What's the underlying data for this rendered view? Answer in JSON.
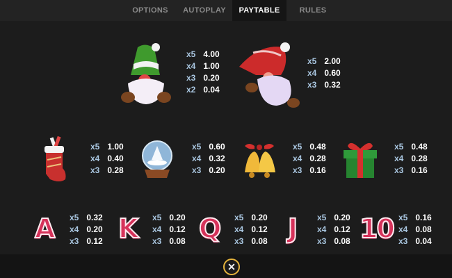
{
  "tabs": [
    {
      "label": "OPTIONS",
      "active": false
    },
    {
      "label": "AUTOPLAY",
      "active": false
    },
    {
      "label": "PAYTABLE",
      "active": true
    },
    {
      "label": "RULES",
      "active": false
    }
  ],
  "paytable": {
    "gnome_green": [
      {
        "mult": "x5",
        "value": "4.00"
      },
      {
        "mult": "x4",
        "value": "1.00"
      },
      {
        "mult": "x3",
        "value": "0.20"
      },
      {
        "mult": "x2",
        "value": "0.04"
      }
    ],
    "gnome_red": [
      {
        "mult": "x5",
        "value": "2.00"
      },
      {
        "mult": "x4",
        "value": "0.60"
      },
      {
        "mult": "x3",
        "value": "0.32"
      }
    ],
    "stocking": [
      {
        "mult": "x5",
        "value": "1.00"
      },
      {
        "mult": "x4",
        "value": "0.40"
      },
      {
        "mult": "x3",
        "value": "0.28"
      }
    ],
    "snowglobe": [
      {
        "mult": "x5",
        "value": "0.60"
      },
      {
        "mult": "x4",
        "value": "0.32"
      },
      {
        "mult": "x3",
        "value": "0.20"
      }
    ],
    "bells": [
      {
        "mult": "x5",
        "value": "0.48"
      },
      {
        "mult": "x4",
        "value": "0.28"
      },
      {
        "mult": "x3",
        "value": "0.16"
      }
    ],
    "gift": [
      {
        "mult": "x5",
        "value": "0.48"
      },
      {
        "mult": "x4",
        "value": "0.28"
      },
      {
        "mult": "x3",
        "value": "0.16"
      }
    ],
    "letter_a": {
      "glyph": "A",
      "pays": [
        {
          "mult": "x5",
          "value": "0.32"
        },
        {
          "mult": "x4",
          "value": "0.20"
        },
        {
          "mult": "x3",
          "value": "0.12"
        }
      ]
    },
    "letter_k": {
      "glyph": "K",
      "pays": [
        {
          "mult": "x5",
          "value": "0.20"
        },
        {
          "mult": "x4",
          "value": "0.12"
        },
        {
          "mult": "x3",
          "value": "0.08"
        }
      ]
    },
    "letter_q": {
      "glyph": "Q",
      "pays": [
        {
          "mult": "x5",
          "value": "0.20"
        },
        {
          "mult": "x4",
          "value": "0.12"
        },
        {
          "mult": "x3",
          "value": "0.08"
        }
      ]
    },
    "letter_j": {
      "glyph": "J",
      "pays": [
        {
          "mult": "x5",
          "value": "0.20"
        },
        {
          "mult": "x4",
          "value": "0.12"
        },
        {
          "mult": "x3",
          "value": "0.08"
        }
      ]
    },
    "letter_10": {
      "glyph": "10",
      "pays": [
        {
          "mult": "x5",
          "value": "0.16"
        },
        {
          "mult": "x4",
          "value": "0.08"
        },
        {
          "mult": "x3",
          "value": "0.04"
        }
      ]
    }
  },
  "close": {
    "glyph": "✕"
  },
  "colors": {
    "accent": "#e6b43c",
    "multiplier": "#a9c6e0",
    "letter": "#d6325a"
  }
}
